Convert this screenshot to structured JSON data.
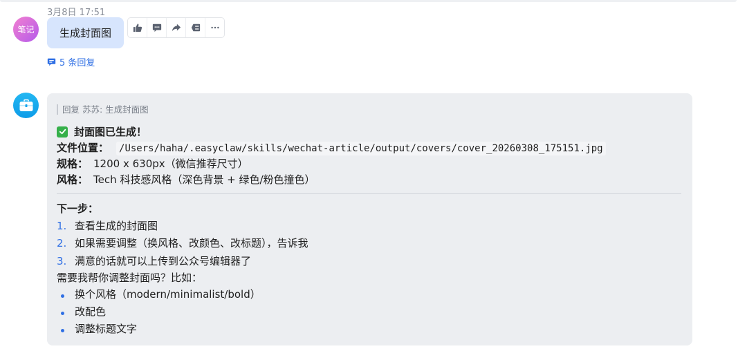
{
  "message": {
    "timestamp": "3月8日 17:51",
    "author_avatar_text": "笔记",
    "text": "生成封面图",
    "reply_count_label": "5 条回复"
  },
  "toolbar": {
    "items": [
      "thumbs-up-icon",
      "comment-icon",
      "forward-icon",
      "quote-icon",
      "more-icon"
    ]
  },
  "reply": {
    "quote": "回复 苏苏: 生成封面图",
    "headline": "封面图已生成！",
    "file_label": "文件位置：",
    "file_path": "/Users/haha/.easyclaw/skills/wechat-article/output/covers/cover_20260308_175151.jpg",
    "spec_label": "规格：",
    "spec_value": "1200 x 630px（微信推荐尺寸）",
    "style_label": "风格：",
    "style_value": "Tech 科技感风格（深色背景 + 绿色/粉色撞色）",
    "next_title": "下一步：",
    "steps": [
      {
        "num": "1.",
        "text": "查看生成的封面图"
      },
      {
        "num": "2.",
        "text": "如果需要调整（换风格、改颜色、改标题），告诉我"
      },
      {
        "num": "3.",
        "text": "满意的话就可以上传到公众号编辑器了"
      }
    ],
    "question": "需要我帮你调整封面吗？比如：",
    "options": [
      "换个风格（modern/minimalist/bold）",
      "改配色",
      "调整标题文字"
    ]
  },
  "colors": {
    "accent": "#2f6fe4",
    "user_bubble": "#d7e5fd",
    "card_bg": "#eceef1",
    "check_green": "#35b04a"
  }
}
